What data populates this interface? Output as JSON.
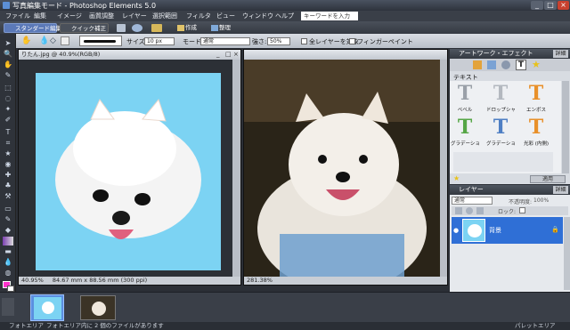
{
  "window": {
    "title": "写真編集モード - Photoshop Elements 5.0"
  },
  "menu": {
    "items": [
      "ファイル",
      "編集",
      "イメージ",
      "画質調整",
      "レイヤー",
      "選択範囲",
      "フィルタ",
      "ビュー",
      "ウィンドウ",
      "ヘルプ"
    ],
    "search_placeholder": "キーワードを入力"
  },
  "modes": {
    "standard": "スタンダード編集",
    "quick": "クイック補正",
    "create": "作成",
    "organize": "整理"
  },
  "options": {
    "size_label": "サイズ:",
    "size_value": "10 px",
    "mode_label": "モード:",
    "mode_value": "通常",
    "strength_label": "強さ:",
    "strength_value": "50%",
    "all_layers": "全レイヤーを対象",
    "finger_paint": "フィンガーペイント"
  },
  "documents": [
    {
      "title": "りたん.jpg @ 40.9%(RGB/8)",
      "zoom": "40.95%",
      "dimensions": "84.67 mm x 88.56 mm (300 ppi)"
    },
    {
      "title": "",
      "zoom": "281.38%",
      "dimensions": ""
    }
  ],
  "artwork_panel": {
    "title": "アートワーク・エフェクト",
    "category": "テキスト",
    "styles": [
      "ベベル",
      "ドロップシャドウ",
      "エンボス",
      "グラデーショ...",
      "グラデーション",
      "光彩 (内側)"
    ],
    "apply": "適用",
    "colors": {
      "orange": "#e8902a",
      "gray": "#9aa0a8",
      "green": "#56a647",
      "blue": "#4f7fc4"
    }
  },
  "layers_panel": {
    "title": "レイヤー",
    "blend_mode": "通常",
    "opacity_label": "不透明度:",
    "opacity_value": "100%",
    "lock_label": "ロック:",
    "layer_name": "背景",
    "detail": "詳細"
  },
  "bin": {
    "thumbnail_count": 2
  },
  "statusbar": {
    "photo_bin": "フォトエリア",
    "message": "フォトエリア内に 2 個のファイルがあります",
    "palette_bin": "パレットエリア"
  }
}
